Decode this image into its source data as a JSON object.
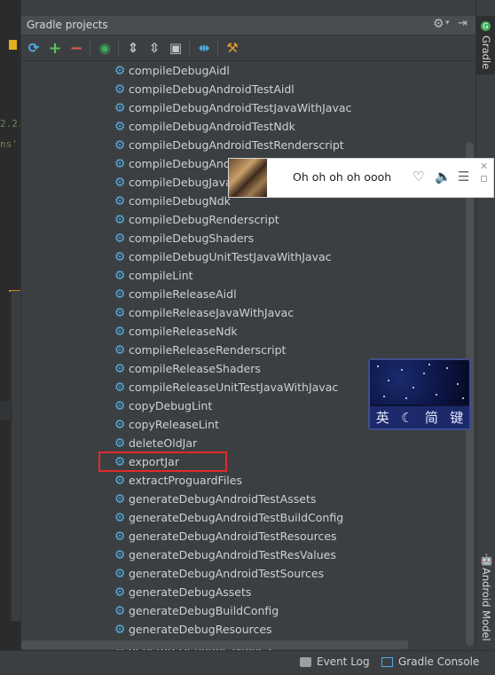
{
  "panel": {
    "title": "Gradle projects"
  },
  "editor": {
    "code_line_1": "2.2.",
    "code_line_2": "ns'"
  },
  "tasks": [
    "compileDebugAidl",
    "compileDebugAndroidTestAidl",
    "compileDebugAndroidTestJavaWithJavac",
    "compileDebugAndroidTestNdk",
    "compileDebugAndroidTestRenderscript",
    "compileDebugAndroidTestShaders",
    "compileDebugJavaWithJavac",
    "compileDebugNdk",
    "compileDebugRenderscript",
    "compileDebugShaders",
    "compileDebugUnitTestJavaWithJavac",
    "compileLint",
    "compileReleaseAidl",
    "compileReleaseJavaWithJavac",
    "compileReleaseNdk",
    "compileReleaseRenderscript",
    "compileReleaseShaders",
    "compileReleaseUnitTestJavaWithJavac",
    "copyDebugLint",
    "copyReleaseLint",
    "deleteOldJar",
    "exportJar",
    "extractProguardFiles",
    "generateDebugAndroidTestAssets",
    "generateDebugAndroidTestBuildConfig",
    "generateDebugAndroidTestResources",
    "generateDebugAndroidTestResValues",
    "generateDebugAndroidTestSources",
    "generateDebugAssets",
    "generateDebugBuildConfig",
    "generateDebugResources",
    "generateDebugResValues"
  ],
  "highlighted_task": "exportJar",
  "side_tabs": {
    "gradle": "Gradle",
    "android_model": "Android Model"
  },
  "status_bar": {
    "event_log": "Event Log",
    "gradle_console": "Gradle Console"
  },
  "music_popup": {
    "song": "Oh oh oh oh oooh"
  },
  "ime": {
    "mode_en": "英",
    "moon": "☾",
    "simplified": "简",
    "keyboard": "键"
  },
  "icons": {
    "task": "gear-icon",
    "accent": "#4eaee8",
    "highlight_color": "#e02b2b"
  }
}
